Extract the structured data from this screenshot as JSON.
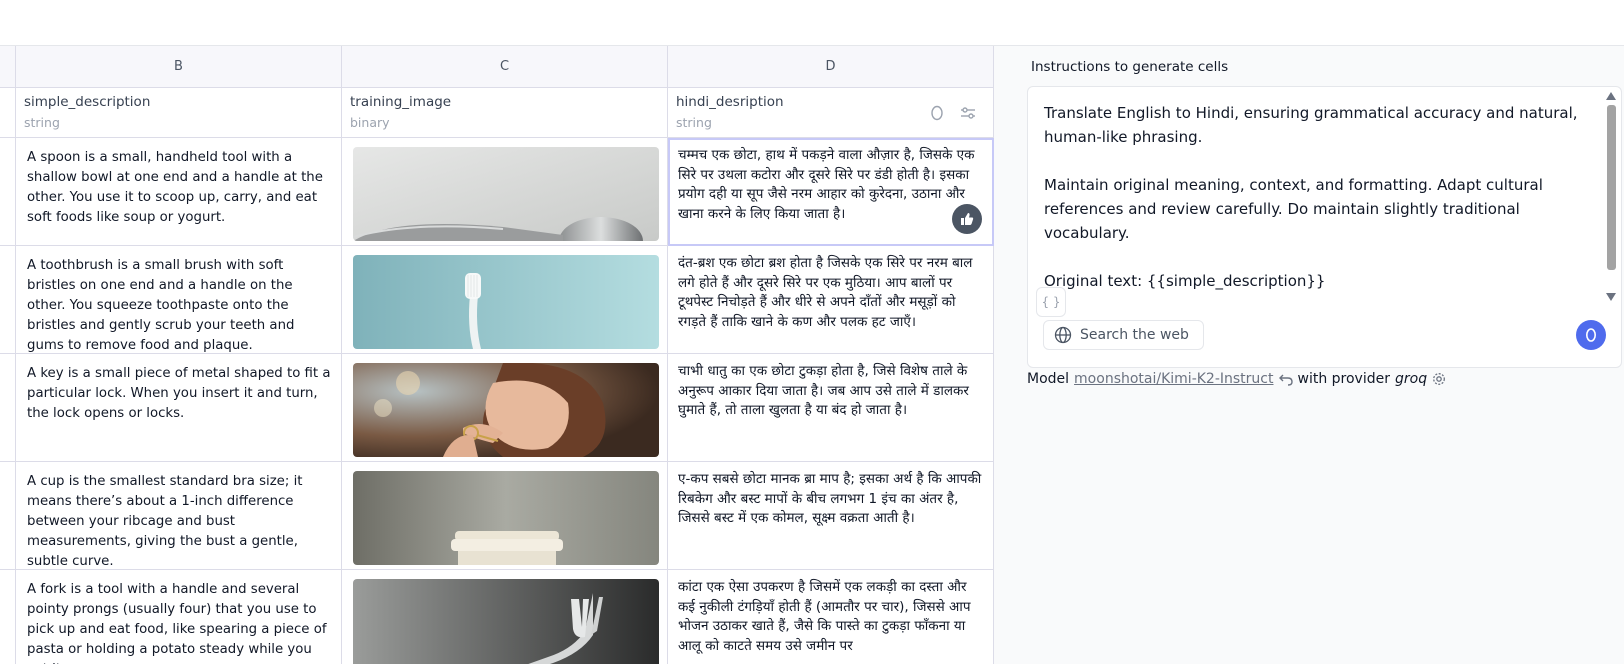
{
  "columns": [
    {
      "letter": "B",
      "name": "simple_description",
      "type": "string"
    },
    {
      "letter": "C",
      "name": "training_image",
      "type": "binary"
    },
    {
      "letter": "D",
      "name": "hindi_desription",
      "type": "string"
    }
  ],
  "rows": [
    {
      "simple_description": "A spoon is a small, handheld tool with a shallow bowl at one end and a handle at the other. You use it to scoop up, carry, and eat soft foods like soup or yogurt.",
      "image": "spoon",
      "hindi": "चम्मच एक छोटा, हाथ में पकड़ने वाला औज़ार है, जिसके एक सिरे पर उथला कटोरा और दूसरे सिरे पर डंडी होती है। इसका प्रयोग दही या सूप जैसे नरम आहार को कुरेदना, उठाना और खाना करने के लिए किया जाता है।"
    },
    {
      "simple_description": "A toothbrush is a small brush with soft bristles on one end and a handle on the other. You squeeze toothpaste onto the bristles and gently scrub your teeth and gums to remove food and plaque.",
      "image": "toothbrush",
      "hindi": "दंत-ब्रश एक छोटा ब्रश होता है जिसके एक सिरे पर नरम बाल लगे होते हैं और दूसरे सिरे पर एक मुठिया। आप बालों पर टूथपेस्ट निचोड़ते हैं और धीरे से अपने दाँतों और मसूड़ों को रगड़ते हैं ताकि खाने के कण और पलक हट जाएँ।"
    },
    {
      "simple_description": "A key is a small piece of metal shaped to fit a particular lock. When you insert it and turn, the lock opens or locks.",
      "image": "woman-with-key",
      "hindi": "चाभी धातु का एक छोटा टुकड़ा होता है, जिसे विशेष ताले के अनुरूप आकार दिया जाता है। जब आप उसे ताले में डालकर घुमाते हैं, तो ताला खुलता है या बंद हो जाता है।"
    },
    {
      "simple_description": "A cup is the smallest standard bra size; it means there’s about a 1-inch difference between your ribcage and bust measurements, giving the bust a gentle, subtle curve.",
      "image": "cup",
      "hindi": "ए-कप सबसे छोटा मानक ब्रा माप है; इसका अर्थ है कि आपकी रिबकेग और बस्ट मापों के बीच लगभग 1 इंच का अंतर है, जिससे बस्ट में एक कोमल, सूक्ष्म वक्रता आती है।"
    },
    {
      "simple_description": "A fork is a tool with a handle and several pointy prongs (usually four) that you use to pick up and eat food, like spearing a piece of pasta or holding a potato steady while you cut it.",
      "image": "fork",
      "hindi": "कांटा एक ऐसा उपकरण है जिसमें एक लकड़ी का दस्ता और कई नुकीली टंगड़ियाँ होती हैं (आमतौर पर चार), जिससे आप भोजन उठाकर खाते हैं, जैसे कि पास्ते का टुकड़ा फाँकना या आलू को काटते समय उसे जमीन पर"
    }
  ],
  "panel": {
    "title": "Instructions to generate cells",
    "prompt": "Translate English to Hindi, ensuring grammatical accuracy and natural, human-like phrasing.\n\nMaintain original meaning, context, and formatting. Adapt cultural references and review carefully. Do maintain slightly traditional vocabulary.\n\nOriginal text: {{simple_description}}",
    "variable_button": "{ }",
    "search_web_label": "Search the web",
    "model_prefix": "Model",
    "model_name": "moonshotai/Kimi-K2-Instruct",
    "provider_prefix": "with provider",
    "provider_name": "groq"
  },
  "colors": {
    "accent": "#4f6bed",
    "grid_border": "#dcdce8",
    "header_bg": "#f7f7fb"
  }
}
